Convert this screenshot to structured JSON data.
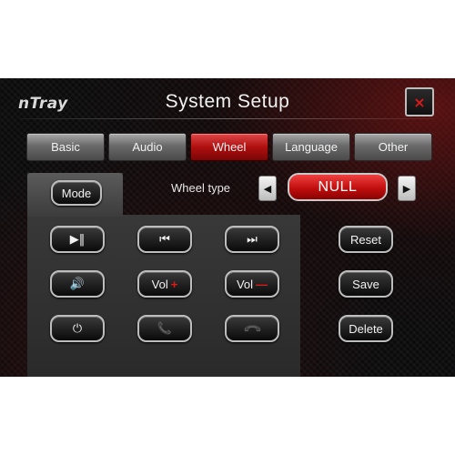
{
  "app": {
    "logo": "nTray",
    "title": "System Setup",
    "close_label": "×"
  },
  "tabs": [
    {
      "label": "Basic",
      "active": false
    },
    {
      "label": "Audio",
      "active": false
    },
    {
      "label": "Wheel",
      "active": true
    },
    {
      "label": "Language",
      "active": false
    },
    {
      "label": "Other",
      "active": false
    }
  ],
  "wheel": {
    "mode_label": "Mode",
    "type_label": "Wheel type",
    "type_value": "NULL",
    "prev_glyph": "◀",
    "next_glyph": "▶"
  },
  "buttons": {
    "play_pause": "▶‖",
    "prev": "⏮",
    "next": "⏭",
    "mute": "🔊",
    "vol_plus_text": "Vol",
    "vol_plus_sign": "+",
    "vol_minus_text": "Vol",
    "vol_minus_sign": "—",
    "power": "⏻",
    "call_answer": "📞",
    "call_hangup": "📞",
    "reset": "Reset",
    "save": "Save",
    "delete": "Delete"
  },
  "colors": {
    "accent_red": "#c10e0e",
    "close_icon": "#e01818",
    "call_green": "#3bbf3b",
    "call_red": "#e01818"
  },
  "icons": [
    "play-pause-icon",
    "previous-icon",
    "next-icon",
    "volume-icon",
    "power-icon",
    "phone-answer-icon",
    "phone-hangup-icon",
    "close-icon",
    "arrow-left-icon",
    "arrow-right-icon"
  ]
}
